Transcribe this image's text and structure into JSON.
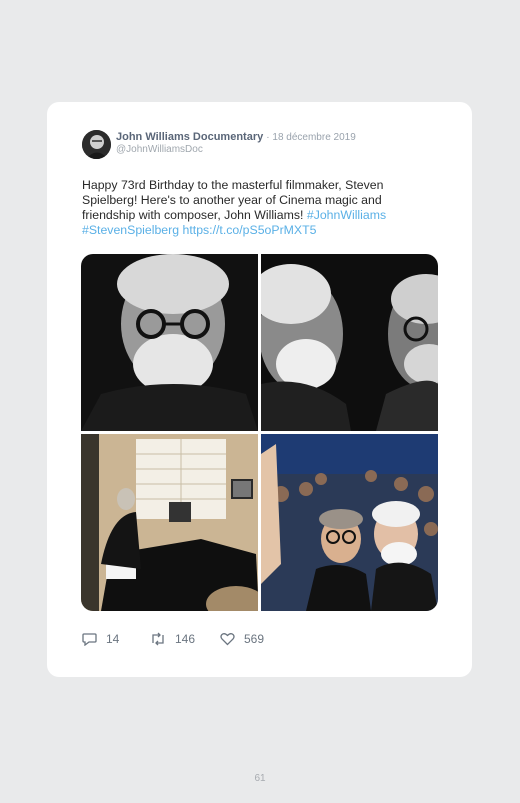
{
  "tweet": {
    "author_name": "John Williams Documentary",
    "date": "· 18 décembre 2019",
    "handle": "@JohnWilliamsDoc",
    "text_plain": "Happy 73rd Birthday to the masterful filmmaker, Steven Spielberg! Here's to another year of Cinema magic and friendship with composer, John Williams! ",
    "hashtag_1": "#JohnWilliams",
    "hashtag_2": "#StevenSpielberg",
    "link": "https://t.co/pS5oPrMXT5",
    "photos": [
      {
        "name": "portrait-spielberg"
      },
      {
        "name": "williams-and-spielberg-bw"
      },
      {
        "name": "williams-at-piano"
      },
      {
        "name": "williams-and-spielberg-event"
      }
    ]
  },
  "actions": {
    "replies_icon": "reply-icon",
    "replies": "14",
    "retweets_icon": "retweet-icon",
    "retweets": "146",
    "likes_icon": "heart-icon",
    "likes": "569"
  },
  "page": {
    "number": "61"
  },
  "colors": {
    "link": "#5ab0e6",
    "name": "#5a6678",
    "background": "#e9eaeb"
  }
}
